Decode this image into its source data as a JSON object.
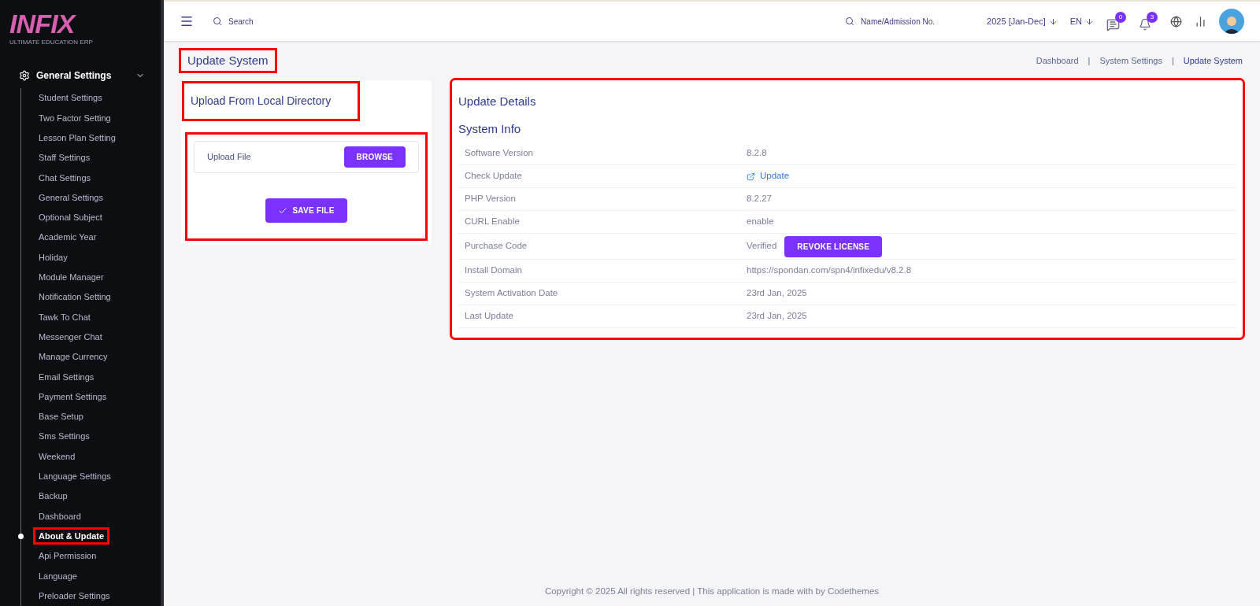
{
  "logo": {
    "name": "INFIX",
    "tagline": "ULTIMATE EDUCATION ERP"
  },
  "sidebar": {
    "group": {
      "label": "General Settings",
      "expanded": true
    },
    "items": [
      {
        "label": "Student Settings",
        "selected": false,
        "highlighted": false
      },
      {
        "label": "Two Factor Setting",
        "selected": false,
        "highlighted": false
      },
      {
        "label": "Lesson Plan Setting",
        "selected": false,
        "highlighted": false
      },
      {
        "label": "Staff Settings",
        "selected": false,
        "highlighted": false
      },
      {
        "label": "Chat Settings",
        "selected": false,
        "highlighted": false
      },
      {
        "label": "General Settings",
        "selected": false,
        "highlighted": false
      },
      {
        "label": "Optional Subject",
        "selected": false,
        "highlighted": false
      },
      {
        "label": "Academic Year",
        "selected": false,
        "highlighted": false
      },
      {
        "label": "Holiday",
        "selected": false,
        "highlighted": false
      },
      {
        "label": "Module Manager",
        "selected": false,
        "highlighted": false
      },
      {
        "label": "Notification Setting",
        "selected": false,
        "highlighted": false
      },
      {
        "label": "Tawk To Chat",
        "selected": false,
        "highlighted": false
      },
      {
        "label": "Messenger Chat",
        "selected": false,
        "highlighted": false
      },
      {
        "label": "Manage Currency",
        "selected": false,
        "highlighted": false
      },
      {
        "label": "Email Settings",
        "selected": false,
        "highlighted": false
      },
      {
        "label": "Payment Settings",
        "selected": false,
        "highlighted": false
      },
      {
        "label": "Base Setup",
        "selected": false,
        "highlighted": false
      },
      {
        "label": "Sms Settings",
        "selected": false,
        "highlighted": false
      },
      {
        "label": "Weekend",
        "selected": false,
        "highlighted": false
      },
      {
        "label": "Language Settings",
        "selected": false,
        "highlighted": false
      },
      {
        "label": "Backup",
        "selected": false,
        "highlighted": false
      },
      {
        "label": "Dashboard",
        "selected": false,
        "highlighted": false
      },
      {
        "label": "About & Update",
        "selected": true,
        "highlighted": true
      },
      {
        "label": "Api Permission",
        "selected": false,
        "highlighted": false
      },
      {
        "label": "Language",
        "selected": false,
        "highlighted": false
      },
      {
        "label": "Preloader Settings",
        "selected": false,
        "highlighted": false
      }
    ]
  },
  "header": {
    "search_placeholder": "Search",
    "student_search_placeholder": "Name/Admission No.",
    "session": "2025 [Jan-Dec]",
    "language": "EN",
    "messages_badge": "0",
    "notifications_badge": "3"
  },
  "page": {
    "title": "Update System",
    "title_highlighted": true,
    "breadcrumb": [
      "Dashboard",
      "System Settings",
      "Update System"
    ],
    "breadcrumb_separator": "|"
  },
  "upload_card": {
    "title": "Upload From Local Directory",
    "title_highlighted": true,
    "form_highlighted": true,
    "file_placeholder": "Upload File",
    "browse_button": "BROWSE",
    "save_button": "SAVE FILE"
  },
  "details": {
    "highlighted": true,
    "title": "Update Details",
    "subtitle": "System Info",
    "rows": [
      {
        "label": "Software Version",
        "kind": "text",
        "value": "8.2.8"
      },
      {
        "label": "Check Update",
        "kind": "link",
        "value": "Update"
      },
      {
        "label": "PHP Version",
        "kind": "text",
        "value": "8.2.27"
      },
      {
        "label": "CURL Enable",
        "kind": "text",
        "value": "enable"
      },
      {
        "label": "Purchase Code",
        "kind": "action",
        "value": "Verified",
        "button": "REVOKE LICENSE"
      },
      {
        "label": "Install Domain",
        "kind": "text",
        "value": "https://spondan.com/spn4/infixedu/v8.2.8"
      },
      {
        "label": "System Activation Date",
        "kind": "text",
        "value": "23rd Jan, 2025"
      },
      {
        "label": "Last Update",
        "kind": "text",
        "value": "23rd Jan, 2025"
      }
    ]
  },
  "footer": "Copyright © 2025 All rights reserved | This application is made with by Codethemes"
}
